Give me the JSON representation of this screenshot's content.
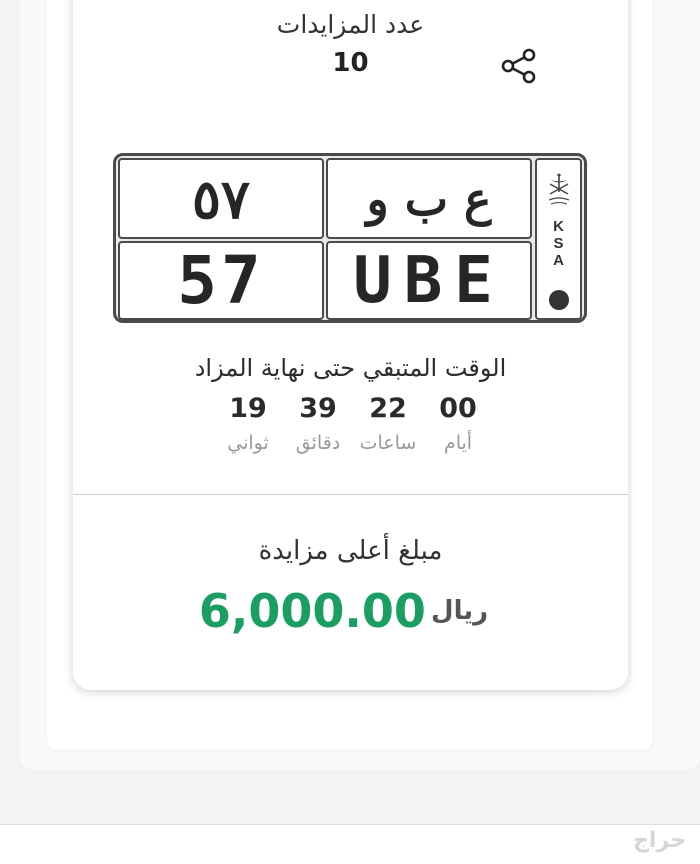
{
  "bids": {
    "label": "عدد المزايدات",
    "count": "10"
  },
  "icons": {
    "share": "share-icon",
    "emblem": "saudi-emblem-icon"
  },
  "plate": {
    "arabic_numbers": "٥٧",
    "arabic_letters": "ع ب و",
    "english_numbers": "57",
    "english_letters": "UBE",
    "country_code": "K S A"
  },
  "countdown": {
    "label": "الوقت المتبقي حتى نهاية المزاد",
    "days": {
      "value": "00",
      "label": "أيام"
    },
    "hours": {
      "value": "22",
      "label": "ساعات"
    },
    "minutes": {
      "value": "39",
      "label": "دقائق"
    },
    "seconds": {
      "value": "19",
      "label": "ثواني"
    }
  },
  "price": {
    "label": "مبلغ أعلى مزايدة",
    "amount": "6,000.00",
    "currency": "ريال"
  },
  "watermark": "حراج",
  "colors": {
    "accent_green": "#1b9e62",
    "plate_border": "#4a4a4a"
  }
}
